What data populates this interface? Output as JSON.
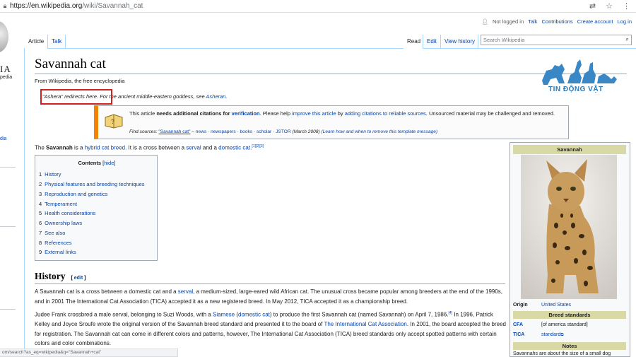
{
  "browser": {
    "url_host": "https://en.wikipedia.org",
    "url_path": "/wiki/Savannah_cat"
  },
  "sidebar": {
    "logo_text": "IA",
    "logo_sub": "pedia",
    "link_fragment": "dia"
  },
  "personal_tools": {
    "not_logged_in": "Not logged in",
    "talk": "Talk",
    "contributions": "Contributions",
    "create_account": "Create account",
    "log_in": "Log in"
  },
  "tabs": {
    "article": "Article",
    "talk": "Talk",
    "read": "Read",
    "edit": "Edit",
    "view_history": "View history"
  },
  "search": {
    "placeholder": "Search Wikipedia"
  },
  "article": {
    "title": "Savannah cat",
    "tagline": "From Wikipedia, the free encyclopedia",
    "hatnote_redirect": "\"Ashera\" redirects here.",
    "hatnote_rest": " For the ancient middle-eastern goddess, see ",
    "hatnote_link": "Asheran",
    "hatnote_end": "."
  },
  "watermark": {
    "brand": "TIN ĐỘNG VẬT"
  },
  "ambox": {
    "t1": "This article ",
    "t2": "needs additional citations for ",
    "t3": "verification",
    "t4": ". Please help ",
    "t5": "improve this article",
    "t6": " by ",
    "t7": "adding citations to reliable sources",
    "t8": ". Unsourced material may be challenged and removed.",
    "find_label": "Find sources: ",
    "find_query": "\"Savannah cat\"",
    "find_sep": " – ",
    "s_news": "news",
    "s_newspapers": "newspapers",
    "s_books": "books",
    "s_scholar": "scholar",
    "s_jstor": "JSTOR",
    "date": " (March 2008) ",
    "learn": "(Learn how and when to remove this template message)"
  },
  "lead": {
    "p1": "The ",
    "bold": "Savannah",
    "p2": " is a ",
    "l1": "hybrid cat breed",
    "p3": ". It is a cross between a ",
    "l2": "serval",
    "p4": " and a ",
    "l3": "domestic cat",
    "p5": ".",
    "refs": "[1][2][3]"
  },
  "toc": {
    "title": "Contents",
    "hide": "hide",
    "items": [
      {
        "num": "1",
        "label": "History"
      },
      {
        "num": "2",
        "label": "Physical features and breeding techniques"
      },
      {
        "num": "3",
        "label": "Reproduction and genetics"
      },
      {
        "num": "4",
        "label": "Temperament"
      },
      {
        "num": "5",
        "label": "Health considerations"
      },
      {
        "num": "6",
        "label": "Ownership laws"
      },
      {
        "num": "7",
        "label": "See also"
      },
      {
        "num": "8",
        "label": "References"
      },
      {
        "num": "9",
        "label": "External links"
      }
    ]
  },
  "history": {
    "heading": "History",
    "edit": "edit",
    "para1_a": "A Savannah cat is a cross between a domestic cat and a ",
    "para1_link": "serval",
    "para1_b": ", a medium-sized, large-eared wild African cat. The unusual cross became popular among breeders at the end of the 1990s, and in 2001 The International Cat Association (TICA) accepted it as a new registered breed. In May 2012, TICA accepted it as a championship breed.",
    "para2_a": "Judee Frank crossbred a male serval, belonging to Suzi Woods, with a ",
    "para2_l1": "Siamese",
    "para2_b": " (",
    "para2_l2": "domestic cat",
    "para2_c": ") to produce the first Savannah cat (named Savannah) on April 7, 1986.",
    "para2_ref": "[4]",
    "para2_d": " In 1996, Patrick Kelley and Joyce Sroufe wrote the original version of the Savannah breed standard and presented it to the board of ",
    "para2_l3": "The International Cat Association",
    "para2_e": ". In 2001, the board accepted the breed for registration. The Savannah cat can come in different colors and patterns, however, The International Cat Association (TICA) breed standards only accept spotted patterns with certain colors and color combinations."
  },
  "infobox": {
    "title": "Savannah",
    "origin_label": "Origin",
    "origin_value": "United States",
    "standards_header": "Breed standards",
    "cfa_label": "CFA",
    "cfa_value": "[of america standard]",
    "tica_label": "TICA",
    "tica_value": "standard",
    "notes_header": "Notes",
    "notes_text": "Savannahs are about the size of a small dog"
  },
  "statusbar": {
    "text": "om/search?as_eq=wikipedia&q=\"Savannah+cat\""
  }
}
